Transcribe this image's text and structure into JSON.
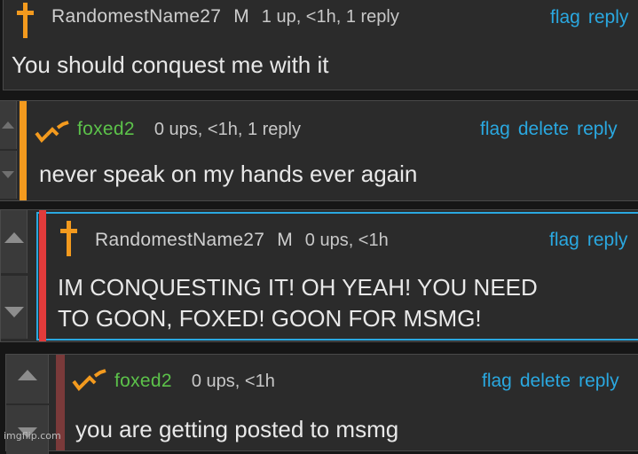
{
  "colors": {
    "link": "#2aa8e0",
    "username_green": "#5cc24a",
    "accent_orange": "#f39a1e",
    "accent_red": "#e23b3b",
    "accent_brown": "#7a3a3a",
    "highlight_blue": "#2aa8e0"
  },
  "comments": [
    {
      "username": "RandomestName27",
      "gender": "M",
      "meta": "1 up, <1h, 1 reply",
      "actions": [
        "flag",
        "reply"
      ],
      "text": "You should conquest me with it",
      "icon": "orange-cross-icon"
    },
    {
      "username": "foxed2",
      "gender": "",
      "meta": "0 ups, <1h, 1 reply",
      "actions": [
        "flag",
        "delete",
        "reply"
      ],
      "text": "never speak on my hands ever again",
      "icon": "rank-chevrons-icon"
    },
    {
      "username": "RandomestName27",
      "gender": "M",
      "meta": "0 ups, <1h",
      "actions": [
        "flag",
        "reply"
      ],
      "text_lines": [
        "IM CONQUESTING IT! OH YEAH! YOU NEED",
        "TO GOON, FOXED! GOON FOR MSMG!"
      ],
      "icon": "orange-cross-icon"
    },
    {
      "username": "foxed2",
      "gender": "",
      "meta": "0 ups, <1h",
      "actions": [
        "flag",
        "delete",
        "reply"
      ],
      "text": "you are getting posted to msmg",
      "icon": "rank-chevrons-icon"
    }
  ],
  "watermark": "imgflip.com"
}
